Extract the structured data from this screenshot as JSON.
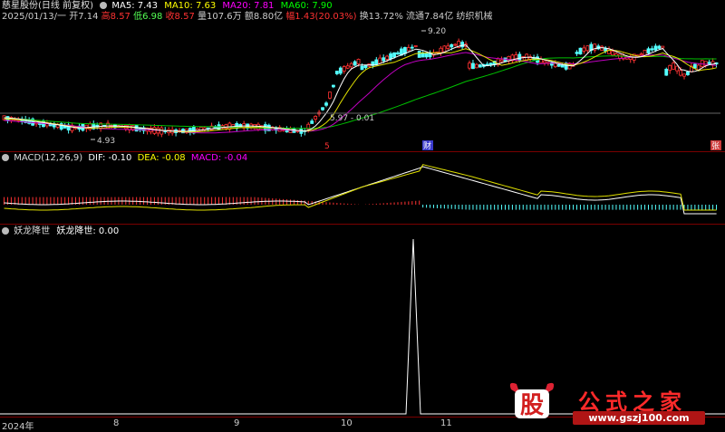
{
  "header": {
    "stock_name": "慈星股份(日线 前复权)",
    "ma5_label": "MA5: 7.43",
    "ma10_label": "MA10: 7.63",
    "ma20_label": "MA20: 7.81",
    "ma60_label": "MA60: 7.90"
  },
  "info": {
    "date": "2025/01/13/一",
    "open": "开7.14",
    "high": "高8.57",
    "low": "低6.98",
    "close": "收8.57",
    "volume": "量107.6万",
    "amount": "额8.80亿",
    "change": "幅1.43(20.03%)",
    "turnover": "换13.72%",
    "float_cap": "流通7.84亿",
    "industry": "纺织机械"
  },
  "main_chart": {
    "annotations": {
      "high": "9.20",
      "low": "4.93",
      "mid": "5.97 - 0.01"
    },
    "markers": {
      "m1": "5",
      "m2": "财",
      "m3": "张"
    }
  },
  "macd": {
    "label": "MACD(12,26,9)",
    "dif": "DIF: -0.10",
    "dea": "DEA: -0.08",
    "macd": "MACD: -0.04"
  },
  "indicator": {
    "name": "妖龙降世",
    "value_label": "妖龙降世: 0.00"
  },
  "axis": {
    "labels": [
      "2024年",
      "8",
      "9",
      "10",
      "11"
    ]
  },
  "watermark": {
    "logo": "股",
    "title": "公式之家",
    "url": "www.gszj100.com"
  },
  "colors": {
    "up": "#ff3232",
    "down": "#54ffff",
    "ma5": "#ffffff",
    "ma10": "#ffff00",
    "ma20": "#ff00ff",
    "ma60": "#00ff00"
  }
}
